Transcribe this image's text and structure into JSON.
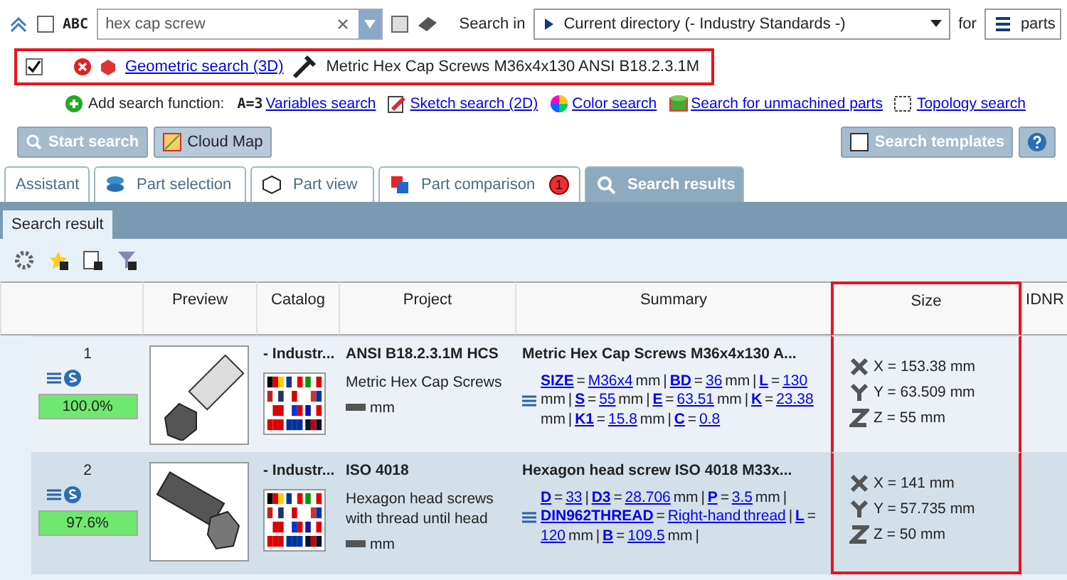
{
  "search_bar": {
    "abc_checked": false,
    "abc_label": "ABC",
    "query": "hex cap screw",
    "extra_checked": false,
    "search_in_label": "Search in",
    "directory": "Current directory (- Industry Standards -)",
    "for_label": "for",
    "target": "parts"
  },
  "filters": [
    {
      "checked": true,
      "highlighted": true,
      "link": "Geometric search (3D)",
      "description": "Metric Hex Cap Screws M36x4x130 ANSI B18.2.3.1M"
    }
  ],
  "add_function": {
    "label": "Add search function:",
    "functions": [
      {
        "kind": "variables",
        "prefix": "A=3",
        "label": "Variables search"
      },
      {
        "kind": "sketch",
        "label": "Sketch search (2D)"
      },
      {
        "kind": "color",
        "label": "Color search"
      },
      {
        "kind": "unmachined",
        "label": "Search for unmachined parts"
      },
      {
        "kind": "topology",
        "label": "Topology search"
      }
    ]
  },
  "buttons": {
    "start": "Start search",
    "cloud": "Cloud Map",
    "templates": "Search templates"
  },
  "tabs": [
    {
      "kind": "assistant",
      "label": "Assistant",
      "selected": false
    },
    {
      "kind": "selection",
      "label": "Part selection",
      "selected": false
    },
    {
      "kind": "view",
      "label": "Part view",
      "selected": false
    },
    {
      "kind": "comparison",
      "label": "Part comparison",
      "selected": false,
      "badge": "1"
    },
    {
      "kind": "results",
      "label": "Search results",
      "selected": true
    }
  ],
  "subtab": "Search result",
  "columns": [
    {
      "label": "Preview",
      "highlighted": false
    },
    {
      "label": "Catalog",
      "highlighted": false
    },
    {
      "label": "Project",
      "highlighted": false
    },
    {
      "label": "Summary",
      "highlighted": false
    },
    {
      "label": "Size",
      "highlighted": true
    },
    {
      "label": "IDNR",
      "highlighted": false
    }
  ],
  "rows": [
    {
      "index": "1",
      "score": "100.0%",
      "selected": false,
      "kind": "capscrew",
      "catalog": "- Industr...",
      "project": "ANSI B18.2.3.1M HCS",
      "description": "Metric Hex Cap Screws",
      "unit": "mm",
      "summary_title": "Metric Hex Cap Screws M36x4x130 A...",
      "summary": [
        {
          "kind": "name",
          "text": "SIZE"
        },
        {
          "kind": "text",
          "text": "="
        },
        {
          "kind": "value",
          "text": "M36x4"
        },
        {
          "kind": "text",
          "text": "mm |"
        },
        {
          "kind": "name",
          "text": "BD"
        },
        {
          "kind": "text",
          "text": "="
        },
        {
          "kind": "value",
          "text": "36"
        },
        {
          "kind": "text",
          "text": "mm |"
        },
        {
          "kind": "name",
          "text": "L"
        },
        {
          "kind": "text",
          "text": "="
        },
        {
          "kind": "value",
          "text": "130"
        },
        {
          "kind": "text",
          "text": "mm |"
        },
        {
          "kind": "name",
          "text": "S"
        },
        {
          "kind": "text",
          "text": "="
        },
        {
          "kind": "value",
          "text": "55"
        },
        {
          "kind": "text",
          "text": "mm |"
        },
        {
          "kind": "name",
          "text": "E"
        },
        {
          "kind": "text",
          "text": "="
        },
        {
          "kind": "value",
          "text": "63.51"
        },
        {
          "kind": "text",
          "text": "mm |"
        },
        {
          "kind": "name",
          "text": "K"
        },
        {
          "kind": "text",
          "text": "="
        },
        {
          "kind": "value",
          "text": "23.38"
        },
        {
          "kind": "text",
          "text": "mm |"
        },
        {
          "kind": "name",
          "text": "K1"
        },
        {
          "kind": "text",
          "text": "="
        },
        {
          "kind": "value",
          "text": "15.8"
        },
        {
          "kind": "text",
          "text": "mm |"
        },
        {
          "kind": "name",
          "text": "C"
        },
        {
          "kind": "text",
          "text": "="
        },
        {
          "kind": "value",
          "text": "0.8"
        }
      ],
      "size": [
        "X = 153.38 mm",
        "Y = 63.509 mm",
        "Z = 55 mm"
      ]
    },
    {
      "index": "2",
      "score": "97.6%",
      "selected": true,
      "kind": "bolt",
      "catalog": "- Industr...",
      "project": "ISO 4018",
      "description": "Hexagon head screws with thread until head",
      "unit": "mm",
      "summary_title": "Hexagon head screw ISO 4018 M33x...",
      "summary": [
        {
          "kind": "name",
          "text": "D"
        },
        {
          "kind": "text",
          "text": "="
        },
        {
          "kind": "value",
          "text": "33"
        },
        {
          "kind": "text",
          "text": "|"
        },
        {
          "kind": "name",
          "text": "D3"
        },
        {
          "kind": "text",
          "text": "="
        },
        {
          "kind": "value",
          "text": "28.706"
        },
        {
          "kind": "text",
          "text": "mm |"
        },
        {
          "kind": "name",
          "text": "P"
        },
        {
          "kind": "text",
          "text": "="
        },
        {
          "kind": "value",
          "text": "3.5"
        },
        {
          "kind": "text",
          "text": "mm |"
        },
        {
          "kind": "name",
          "text": "DIN962THREAD"
        },
        {
          "kind": "text",
          "text": "="
        },
        {
          "kind": "value",
          "text": "Right-hand thread"
        },
        {
          "kind": "text",
          "text": "|"
        },
        {
          "kind": "name",
          "text": "L"
        },
        {
          "kind": "text",
          "text": "="
        },
        {
          "kind": "value",
          "text": "120"
        },
        {
          "kind": "text",
          "text": "mm |"
        },
        {
          "kind": "name",
          "text": "B"
        },
        {
          "kind": "text",
          "text": "="
        },
        {
          "kind": "value",
          "text": "109.5"
        },
        {
          "kind": "text",
          "text": "mm |"
        }
      ],
      "size": [
        "X = 141 mm",
        "Y = 57.735 mm",
        "Z = 50 mm"
      ]
    }
  ]
}
